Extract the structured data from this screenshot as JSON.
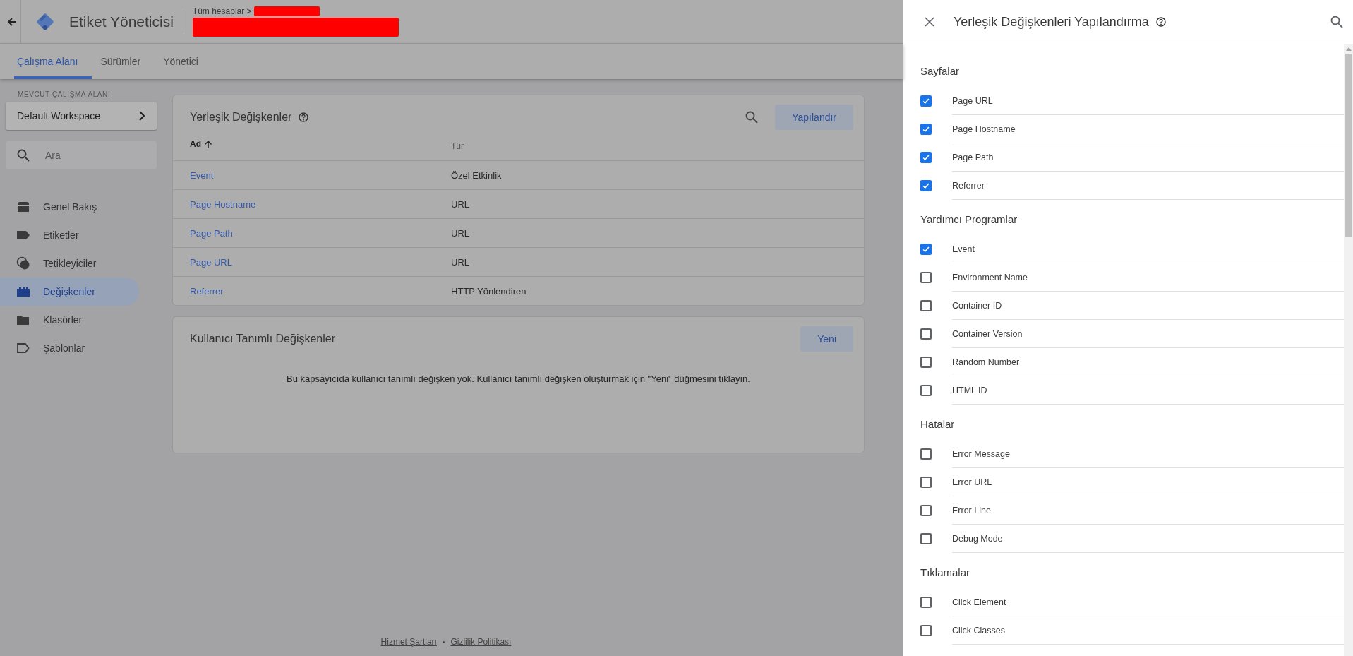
{
  "header": {
    "app_title": "Etiket Yöneticisi",
    "breadcrumb": "Tüm hesaplar >"
  },
  "tabs": [
    {
      "label": "Çalışma Alanı",
      "selected": true
    },
    {
      "label": "Sürümler",
      "selected": false
    },
    {
      "label": "Yönetici",
      "selected": false
    }
  ],
  "sidebar": {
    "workspace_label": "MEVCUT ÇALIŞMA ALANI",
    "workspace": "Default Workspace",
    "search": {
      "placeholder": "Ara"
    },
    "items": [
      {
        "label": "Genel Bakış",
        "selected": false
      },
      {
        "label": "Etiketler",
        "selected": false
      },
      {
        "label": "Tetikleyiciler",
        "selected": false
      },
      {
        "label": "Değişkenler",
        "selected": true
      },
      {
        "label": "Klasörler",
        "selected": false
      },
      {
        "label": "Şablonlar",
        "selected": false
      }
    ]
  },
  "builtin_card": {
    "title": "Yerleşik Değişkenler",
    "button": "Yapılandır",
    "columns": [
      "Ad",
      "Tür"
    ],
    "rows": [
      {
        "name": "Event",
        "type": "Özel Etkinlik"
      },
      {
        "name": "Page Hostname",
        "type": "URL"
      },
      {
        "name": "Page Path",
        "type": "URL"
      },
      {
        "name": "Page URL",
        "type": "URL"
      },
      {
        "name": "Referrer",
        "type": "HTTP Yönlendiren"
      }
    ]
  },
  "user_card": {
    "title": "Kullanıcı Tanımlı Değişkenler",
    "button": "Yeni",
    "empty_message": "Bu kapsayıcıda kullanıcı tanımlı değişken yok. Kullanıcı tanımlı değişken oluşturmak için \"Yeni\" düğmesini tıklayın."
  },
  "footer": {
    "links": [
      "Hizmet Şartları",
      "Gizlilik Politikası"
    ],
    "separator": "•"
  },
  "panel": {
    "title": "Yerleşik Değişkenleri Yapılandırma",
    "sections": [
      {
        "title": "Sayfalar",
        "items": [
          {
            "label": "Page URL",
            "checked": true
          },
          {
            "label": "Page Hostname",
            "checked": true
          },
          {
            "label": "Page Path",
            "checked": true
          },
          {
            "label": "Referrer",
            "checked": true
          }
        ]
      },
      {
        "title": "Yardımcı Programlar",
        "items": [
          {
            "label": "Event",
            "checked": true
          },
          {
            "label": "Environment Name",
            "checked": false
          },
          {
            "label": "Container ID",
            "checked": false
          },
          {
            "label": "Container Version",
            "checked": false
          },
          {
            "label": "Random Number",
            "checked": false
          },
          {
            "label": "HTML ID",
            "checked": false
          }
        ]
      },
      {
        "title": "Hatalar",
        "items": [
          {
            "label": "Error Message",
            "checked": false
          },
          {
            "label": "Error URL",
            "checked": false
          },
          {
            "label": "Error Line",
            "checked": false
          },
          {
            "label": "Debug Mode",
            "checked": false
          }
        ]
      },
      {
        "title": "Tıklamalar",
        "items": [
          {
            "label": "Click Element",
            "checked": false
          },
          {
            "label": "Click Classes",
            "checked": false
          }
        ]
      }
    ]
  }
}
